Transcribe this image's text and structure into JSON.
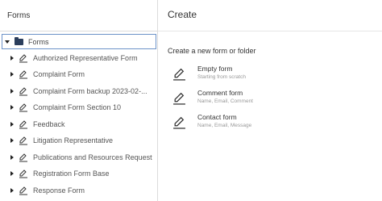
{
  "left": {
    "header_title": "Forms",
    "root_label": "Forms",
    "items": [
      {
        "label": "Authorized Representative Form"
      },
      {
        "label": "Complaint Form"
      },
      {
        "label": "Complaint Form backup 2023-02-..."
      },
      {
        "label": "Complaint Form Section 10"
      },
      {
        "label": "Feedback"
      },
      {
        "label": "Litigation Representative"
      },
      {
        "label": "Publications and Resources Request"
      },
      {
        "label": "Registration Form Base"
      },
      {
        "label": "Response Form"
      }
    ]
  },
  "right": {
    "header_title": "Create",
    "section_title": "Create a new form or folder",
    "options": [
      {
        "title": "Empty form",
        "subtitle": "Starting from scratch"
      },
      {
        "title": "Comment form",
        "subtitle": "Name, Email, Comment"
      },
      {
        "title": "Contact form",
        "subtitle": "Name, Email, Message"
      }
    ]
  },
  "icons": {
    "root": "folder-icon",
    "items": "edit-form-icon",
    "options": "edit-form-icon"
  },
  "colors": {
    "selection_border": "#6d93c9",
    "folder": "#2b3e5c"
  }
}
